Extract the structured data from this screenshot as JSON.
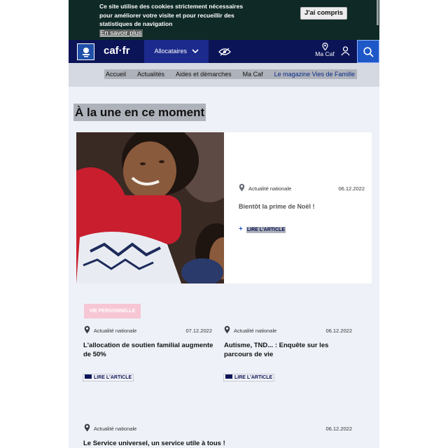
{
  "cookie_banner": {
    "line1": "Ce site utilise des cookies strictement nécessaires",
    "line2": "pour améliorer votre visite et pour recueillir des",
    "line3": "statistiques de navigation",
    "learn_more": "En savoir plus",
    "accept": "J'ai compris"
  },
  "header": {
    "brand": "caf·fr",
    "menu": "Allocataires",
    "ma_caf": "Ma Caf",
    "icons": [
      "logo-icon",
      "eye-icon",
      "location-pin-icon",
      "user-icon",
      "search-icon"
    ]
  },
  "nav": {
    "items": [
      "Accueil",
      "Actualités",
      "Aides et démarches",
      "Ma Caf",
      "Le magazine Vies de Famille"
    ]
  },
  "section_title": "À la une en ce moment",
  "featured": {
    "category": "Actualité nationale",
    "date": "06.12.2022",
    "title": "Bientôt la prime de Noël !",
    "read": "LIRE L'ARTICLE"
  },
  "tag": "VIE PERSONNELLE",
  "articles": [
    {
      "category": "Actualité nationale",
      "date": "07.12.2022",
      "title_line1": "L'allocation de soutien familial augmente",
      "title_line2": "de 50%",
      "read": "LIRE L'ARTICLE"
    },
    {
      "category": "Actualité nationale",
      "date": "06.12.2022",
      "title_line1": "Autisme, TND... : Enquête sur les",
      "title_line2": "parcours de vie",
      "read": "LIRE L'ARTICLE"
    },
    {
      "category": "Actualité nationale",
      "date": "06.12.2022",
      "title_line1": "Le Service universel, un service utile à tous !"
    }
  ],
  "colors": {
    "header_bg": "#0b1457",
    "cookie_bg": "#0f2a26",
    "page_bg": "#eef1f8",
    "accent": "#1e57c7",
    "tag_bg": "#f7c6d4"
  }
}
